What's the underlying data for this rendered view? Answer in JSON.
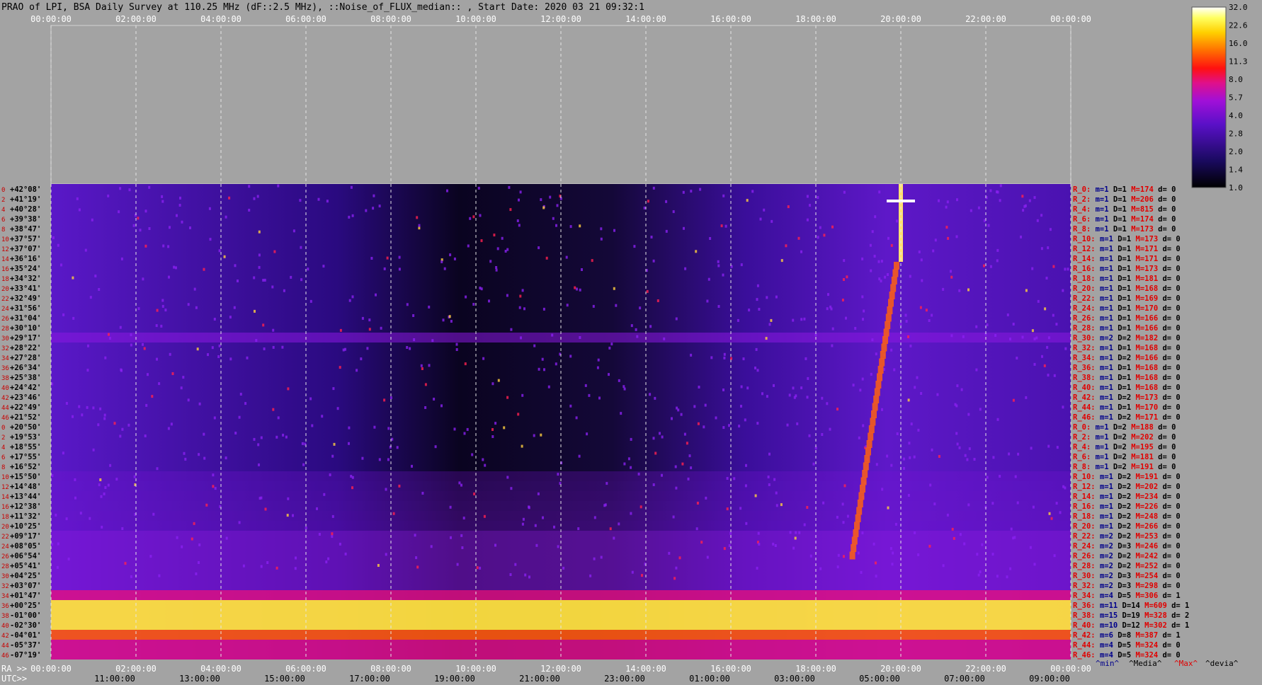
{
  "title": "PRAO of LPI, BSA Daily Survey at 110.25 MHz (dF::2.5 MHz), ::Noise_of_FLUX_median:: , Start Date: 2020 03 21 09:32:1",
  "axis_prefix_ra": "RA >>",
  "axis_prefix_utc": "UTC>>",
  "legend_footer": {
    "min": "^min^",
    "median": "^Media^",
    "max": "^Max^",
    "devia": "^devia^"
  },
  "colors": {
    "background": "#a3a3a3",
    "ra_tick": "#ffffff",
    "row_index": "#c80000",
    "beam_label": "#e00000",
    "footer_min": "#00008b",
    "footer_max": "#e00000"
  },
  "chart_data": {
    "type": "heatmap",
    "title": "PRAO of LPI, BSA Daily Survey at 110.25 MHz (dF::2.5 MHz), ::Noise_of_FLUX_median:: , Start Date: 2020 03 21 09:32:1",
    "x_ra_ticks": [
      "00:00:00",
      "02:00:00",
      "04:00:00",
      "06:00:00",
      "08:00:00",
      "10:00:00",
      "12:00:00",
      "14:00:00",
      "16:00:00",
      "18:00:00",
      "20:00:00",
      "22:00:00",
      "00:00:00"
    ],
    "x_utc_ticks": [
      "11:00:00",
      "13:00:00",
      "15:00:00",
      "17:00:00",
      "19:00:00",
      "21:00:00",
      "23:00:00",
      "01:00:00",
      "03:00:00",
      "05:00:00",
      "07:00:00",
      "09:00:00"
    ],
    "colorbar_ticks": [
      "32.0",
      "22.6",
      "16.0",
      "11.3",
      "8.0",
      "5.7",
      "4.0",
      "2.8",
      "2.0",
      "1.4",
      "1.0"
    ],
    "colorbar_scale": "log",
    "row_indices": [
      "0",
      "2",
      "4",
      "6",
      "8",
      "10",
      "12",
      "14",
      "16",
      "18",
      "20",
      "22",
      "24",
      "26",
      "28",
      "30",
      "32",
      "34",
      "36",
      "38",
      "40",
      "42",
      "44",
      "46",
      "0",
      "2",
      "4",
      "6",
      "8",
      "10",
      "12",
      "14",
      "16",
      "18",
      "20",
      "22",
      "24",
      "26",
      "28",
      "30",
      "32",
      "34",
      "36",
      "38",
      "40",
      "42",
      "44",
      "46"
    ],
    "declinations": [
      "+42°08'",
      "+41°19'",
      "+40°28'",
      "+39°38'",
      "+38°47'",
      "+37°57'",
      "+37°07'",
      "+36°16'",
      "+35°24'",
      "+34°32'",
      "+33°41'",
      "+32°49'",
      "+31°56'",
      "+31°04'",
      "+30°10'",
      "+29°17'",
      "+28°22'",
      "+27°28'",
      "+26°34'",
      "+25°38'",
      "+24°42'",
      "+23°46'",
      "+22°49'",
      "+21°52'",
      "+20°50'",
      "+19°53'",
      "+18°55'",
      "+17°55'",
      "+16°52'",
      "+15°50'",
      "+14°48'",
      "+13°44'",
      "+12°38'",
      "+11°32'",
      "+10°25'",
      "+09°17'",
      "+08°05'",
      "+06°54'",
      "+05°41'",
      "+04°25'",
      "+03°07'",
      "+01°47'",
      "+00°25'",
      "-01°00'",
      "-02°30'",
      "-04°01'",
      "-05°37'",
      "-07°19'"
    ],
    "beam_stats": [
      {
        "beam": "R_0:",
        "m": 1,
        "D": 1,
        "M": 174,
        "d": 0
      },
      {
        "beam": "R_2:",
        "m": 1,
        "D": 1,
        "M": 206,
        "d": 0
      },
      {
        "beam": "R_4:",
        "m": 1,
        "D": 1,
        "M": 815,
        "d": 0
      },
      {
        "beam": "R_6:",
        "m": 1,
        "D": 1,
        "M": 174,
        "d": 0
      },
      {
        "beam": "R_8:",
        "m": 1,
        "D": 1,
        "M": 173,
        "d": 0
      },
      {
        "beam": "R_10:",
        "m": 1,
        "D": 1,
        "M": 173,
        "d": 0
      },
      {
        "beam": "R_12:",
        "m": 1,
        "D": 1,
        "M": 171,
        "d": 0
      },
      {
        "beam": "R_14:",
        "m": 1,
        "D": 1,
        "M": 171,
        "d": 0
      },
      {
        "beam": "R_16:",
        "m": 1,
        "D": 1,
        "M": 173,
        "d": 0
      },
      {
        "beam": "R_18:",
        "m": 1,
        "D": 1,
        "M": 181,
        "d": 0
      },
      {
        "beam": "R_20:",
        "m": 1,
        "D": 1,
        "M": 168,
        "d": 0
      },
      {
        "beam": "R_22:",
        "m": 1,
        "D": 1,
        "M": 169,
        "d": 0
      },
      {
        "beam": "R_24:",
        "m": 1,
        "D": 1,
        "M": 170,
        "d": 0
      },
      {
        "beam": "R_26:",
        "m": 1,
        "D": 1,
        "M": 166,
        "d": 0
      },
      {
        "beam": "R_28:",
        "m": 1,
        "D": 1,
        "M": 166,
        "d": 0
      },
      {
        "beam": "R_30:",
        "m": 2,
        "D": 2,
        "M": 182,
        "d": 0
      },
      {
        "beam": "R_32:",
        "m": 1,
        "D": 1,
        "M": 168,
        "d": 0
      },
      {
        "beam": "R_34:",
        "m": 1,
        "D": 2,
        "M": 166,
        "d": 0
      },
      {
        "beam": "R_36:",
        "m": 1,
        "D": 1,
        "M": 168,
        "d": 0
      },
      {
        "beam": "R_38:",
        "m": 1,
        "D": 1,
        "M": 168,
        "d": 0
      },
      {
        "beam": "R_40:",
        "m": 1,
        "D": 1,
        "M": 168,
        "d": 0
      },
      {
        "beam": "R_42:",
        "m": 1,
        "D": 2,
        "M": 173,
        "d": 0
      },
      {
        "beam": "R_44:",
        "m": 1,
        "D": 1,
        "M": 170,
        "d": 0
      },
      {
        "beam": "R_46:",
        "m": 1,
        "D": 2,
        "M": 171,
        "d": 0
      },
      {
        "beam": "R_0:",
        "m": 1,
        "D": 2,
        "M": 188,
        "d": 0
      },
      {
        "beam": "R_2:",
        "m": 1,
        "D": 2,
        "M": 202,
        "d": 0
      },
      {
        "beam": "R_4:",
        "m": 1,
        "D": 2,
        "M": 195,
        "d": 0
      },
      {
        "beam": "R_6:",
        "m": 1,
        "D": 2,
        "M": 181,
        "d": 0
      },
      {
        "beam": "R_8:",
        "m": 1,
        "D": 2,
        "M": 191,
        "d": 0
      },
      {
        "beam": "R_10:",
        "m": 1,
        "D": 2,
        "M": 191,
        "d": 0
      },
      {
        "beam": "R_12:",
        "m": 1,
        "D": 2,
        "M": 202,
        "d": 0
      },
      {
        "beam": "R_14:",
        "m": 1,
        "D": 2,
        "M": 234,
        "d": 0
      },
      {
        "beam": "R_16:",
        "m": 1,
        "D": 2,
        "M": 226,
        "d": 0
      },
      {
        "beam": "R_18:",
        "m": 1,
        "D": 2,
        "M": 248,
        "d": 0
      },
      {
        "beam": "R_20:",
        "m": 1,
        "D": 2,
        "M": 266,
        "d": 0
      },
      {
        "beam": "R_22:",
        "m": 2,
        "D": 2,
        "M": 253,
        "d": 0
      },
      {
        "beam": "R_24:",
        "m": 2,
        "D": 3,
        "M": 246,
        "d": 0
      },
      {
        "beam": "R_26:",
        "m": 2,
        "D": 2,
        "M": 242,
        "d": 0
      },
      {
        "beam": "R_28:",
        "m": 2,
        "D": 2,
        "M": 252,
        "d": 0
      },
      {
        "beam": "R_30:",
        "m": 2,
        "D": 3,
        "M": 254,
        "d": 0
      },
      {
        "beam": "R_32:",
        "m": 2,
        "D": 3,
        "M": 298,
        "d": 0
      },
      {
        "beam": "R_34:",
        "m": 4,
        "D": 5,
        "M": 306,
        "d": 1
      },
      {
        "beam": "R_36:",
        "m": 11,
        "D": 14,
        "M": 609,
        "d": 1
      },
      {
        "beam": "R_38:",
        "m": 15,
        "D": 19,
        "M": 328,
        "d": 2
      },
      {
        "beam": "R_40:",
        "m": 10,
        "D": 12,
        "M": 302,
        "d": 1
      },
      {
        "beam": "R_42:",
        "m": 6,
        "D": 8,
        "M": 387,
        "d": 1
      },
      {
        "beam": "R_44:",
        "m": 4,
        "D": 5,
        "M": 324,
        "d": 0
      },
      {
        "beam": "R_46:",
        "m": 4,
        "D": 5,
        "M": 324,
        "d": 0
      }
    ]
  }
}
